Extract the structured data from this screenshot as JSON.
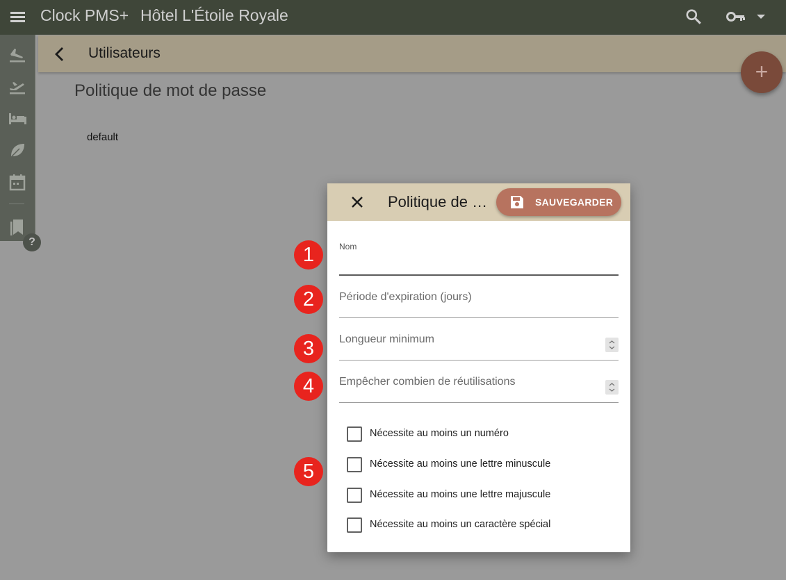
{
  "topbar": {
    "app_name": "Clock PMS+",
    "hotel_name": "Hôtel L'Étoile Royale",
    "icons": [
      "menu-icon",
      "search-icon",
      "key-icon",
      "caret-down-icon"
    ]
  },
  "rail": {
    "icons": [
      "arrivals-icon",
      "departures-icon",
      "bed-icon",
      "leaf-icon",
      "calendar-icon",
      "bookmark-icon"
    ],
    "help_label": "?"
  },
  "page": {
    "header_title": "Utilisateurs",
    "section_title": "Politique de mot de passe",
    "list": [
      "default"
    ],
    "fab_label": "+"
  },
  "dialog": {
    "title": "Politique de mot de passe",
    "save_label": "SAUVEGARDER",
    "fields": {
      "name_label": "Nom",
      "name_value": "",
      "expiration_label": "Période d'expiration (jours)",
      "min_length_label": "Longueur minimum",
      "reuse_label": "Empêcher combien de réutilisations"
    },
    "checkboxes": [
      {
        "label": "Nécessite au moins un numéro",
        "checked": false
      },
      {
        "label": "Nécessite au moins une lettre minuscule",
        "checked": false
      },
      {
        "label": "Nécessite au moins une lettre majuscule",
        "checked": false
      },
      {
        "label": "Nécessite au moins un caractère spécial",
        "checked": false
      }
    ]
  },
  "markers": [
    "1",
    "2",
    "3",
    "4",
    "5"
  ],
  "colors": {
    "topbar": "#3f4639",
    "header": "#a59c87",
    "dialog_header": "#d8cdb3",
    "save_button": "#b7735f",
    "marker": "#e8241e"
  }
}
